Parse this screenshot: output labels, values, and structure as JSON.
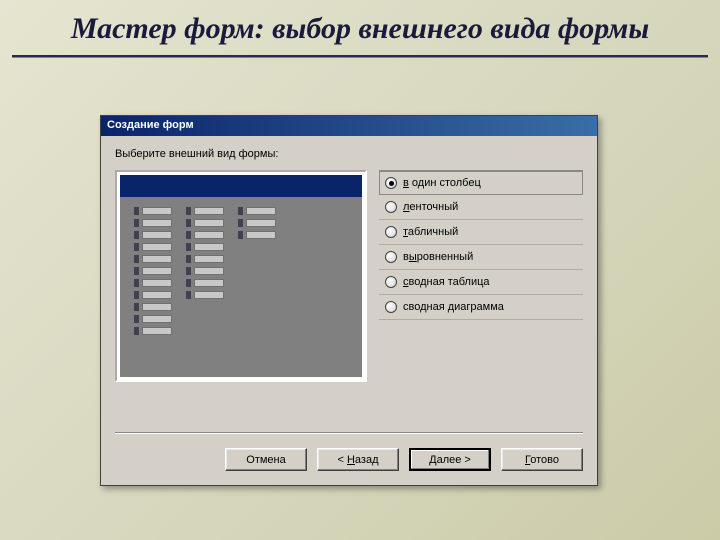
{
  "slide": {
    "title": "Мастер форм: выбор внешнего вида формы"
  },
  "dialog": {
    "title": "Создание форм",
    "instruction": "Выберите внешний вид формы:",
    "options": [
      {
        "label": "в один столбец",
        "hotkey_index": 0,
        "checked": true
      },
      {
        "label": "ленточный",
        "hotkey_index": 0,
        "checked": false
      },
      {
        "label": "табличный",
        "hotkey_index": 0,
        "checked": false
      },
      {
        "label": "выровненный",
        "hotkey_index": 1,
        "checked": false
      },
      {
        "label": "сводная таблица",
        "hotkey_index": 0,
        "checked": false
      },
      {
        "label": "сводная диаграмма",
        "hotkey_index": 8,
        "checked": false
      }
    ],
    "buttons": {
      "cancel": "Отмена",
      "back": "< Назад",
      "next": "Далее >",
      "finish": "Готово"
    }
  }
}
